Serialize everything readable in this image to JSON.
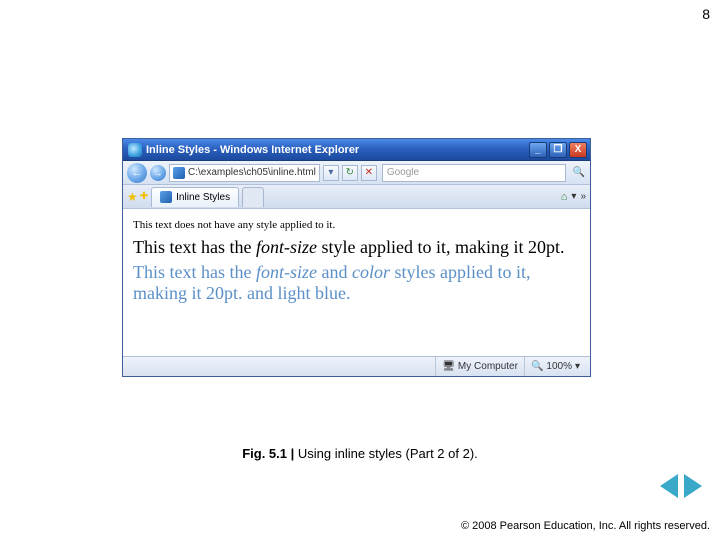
{
  "page_number": "8",
  "window": {
    "title": "Inline Styles - Windows Internet Explorer",
    "address": "C:\\examples\\ch05\\inline.html",
    "search_placeholder": "Google",
    "tab_label": "Inline Styles",
    "minimize": "_",
    "maximize": "❐",
    "close": "X",
    "back": "←",
    "fwd": "→",
    "dropdown": "▾",
    "refresh": "↻",
    "stop": "✕",
    "star": "★",
    "plus": "✚",
    "home": "⌂",
    "overflow": "»",
    "toolbar_caret": "▾"
  },
  "content": {
    "p1": "This text does not have any style applied to it.",
    "p2a": "This text has the ",
    "p2b": "font-size",
    "p2c": " style applied to it, making it 20pt.",
    "p3a": "This text has the ",
    "p3b": "font-size",
    "p3c": " and ",
    "p3d": "color",
    "p3e": " styles applied to it, making it 20pt. and light blue."
  },
  "status": {
    "zone": "My Computer",
    "zoom": "100%",
    "zone_icon": "🖥",
    "zoom_icon": "🔍"
  },
  "caption": {
    "fig": "Fig. 5.1 |",
    "text": " Using inline styles (Part 2 of 2)."
  },
  "copyright": "© 2008 Pearson Education, Inc.  All rights reserved."
}
